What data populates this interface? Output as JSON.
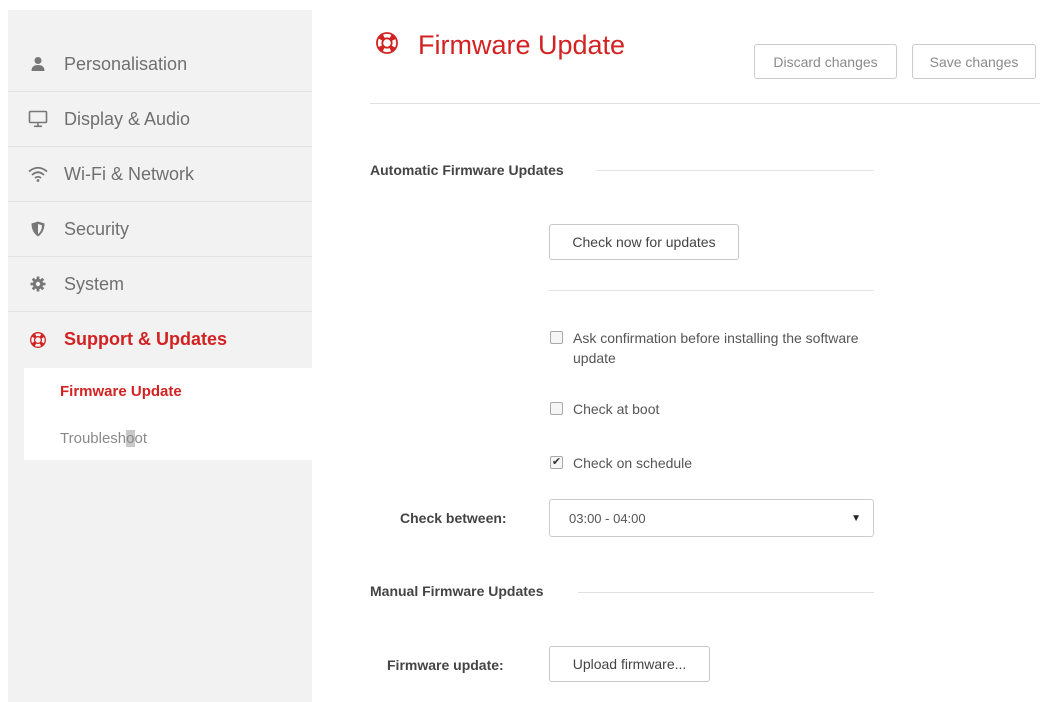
{
  "sidebar": {
    "items": [
      {
        "label": "Personalisation",
        "icon": "user-icon"
      },
      {
        "label": "Display & Audio",
        "icon": "monitor-icon"
      },
      {
        "label": "Wi-Fi & Network",
        "icon": "wifi-icon"
      },
      {
        "label": "Security",
        "icon": "shield-icon"
      },
      {
        "label": "System",
        "icon": "gear-icon"
      },
      {
        "label": "Support & Updates",
        "icon": "lifebuoy-icon"
      }
    ],
    "subitems": [
      {
        "label": "Firmware Update"
      },
      {
        "label_pre": "Troublesh",
        "label_cursor": "o",
        "label_post": "ot"
      }
    ]
  },
  "header": {
    "title": "Firmware Update",
    "icon": "lifebuoy-icon",
    "discard_label": "Discard changes",
    "save_label": "Save changes"
  },
  "auto": {
    "title": "Automatic Firmware Updates",
    "check_now_label": "Check now for updates",
    "options": [
      {
        "label": "Ask confirmation before installing the software update",
        "checked": false
      },
      {
        "label": "Check at boot",
        "checked": false
      },
      {
        "label": "Check on schedule",
        "checked": true
      }
    ],
    "check_between_label": "Check between:",
    "check_between_value": "03:00 - 04:00"
  },
  "manual": {
    "title": "Manual Firmware Updates",
    "firmware_label": "Firmware update:",
    "upload_label": "Upload firmware..."
  },
  "colors": {
    "accent": "#d32222",
    "sidebar_bg": "#f2f2f2"
  }
}
